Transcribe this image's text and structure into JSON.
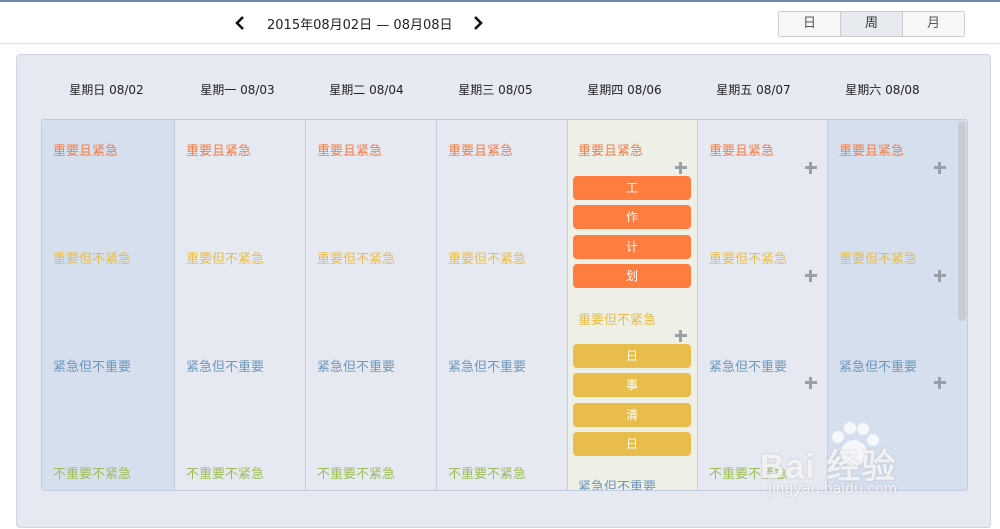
{
  "toolbar": {
    "date_range": "2015年08月02日 — 08月08日",
    "prev_icon": "chevron-left-icon",
    "next_icon": "chevron-right-icon",
    "views": [
      "日",
      "周",
      "月"
    ],
    "active_view": "周"
  },
  "days": [
    {
      "header": "星期日 08/02"
    },
    {
      "header": "星期一 08/03"
    },
    {
      "header": "星期二 08/04"
    },
    {
      "header": "星期三 08/05"
    },
    {
      "header": "星期四 08/06"
    },
    {
      "header": "星期五 08/07"
    },
    {
      "header": "星期六 08/08"
    }
  ],
  "quadrants": {
    "q1": "重要且紧急",
    "q2": "重要但不紧急",
    "q3": "紧急但不重要",
    "q4": "不重要不紧急"
  },
  "colors": {
    "q1": "#f07f4c",
    "q2": "#e8bd4b",
    "q3": "#6f97bb",
    "q4": "#9dbd5c",
    "task_orange": "#ff7d3e",
    "task_yellow": "#e8bd4b"
  },
  "today_tasks": {
    "important_urgent": [
      "工",
      "作",
      "计",
      "划"
    ],
    "important_not_urgent": [
      "日",
      "事",
      "清",
      "日"
    ]
  },
  "watermark": {
    "brand": "Bai 经验",
    "url": "jingyan.baidu.com"
  }
}
